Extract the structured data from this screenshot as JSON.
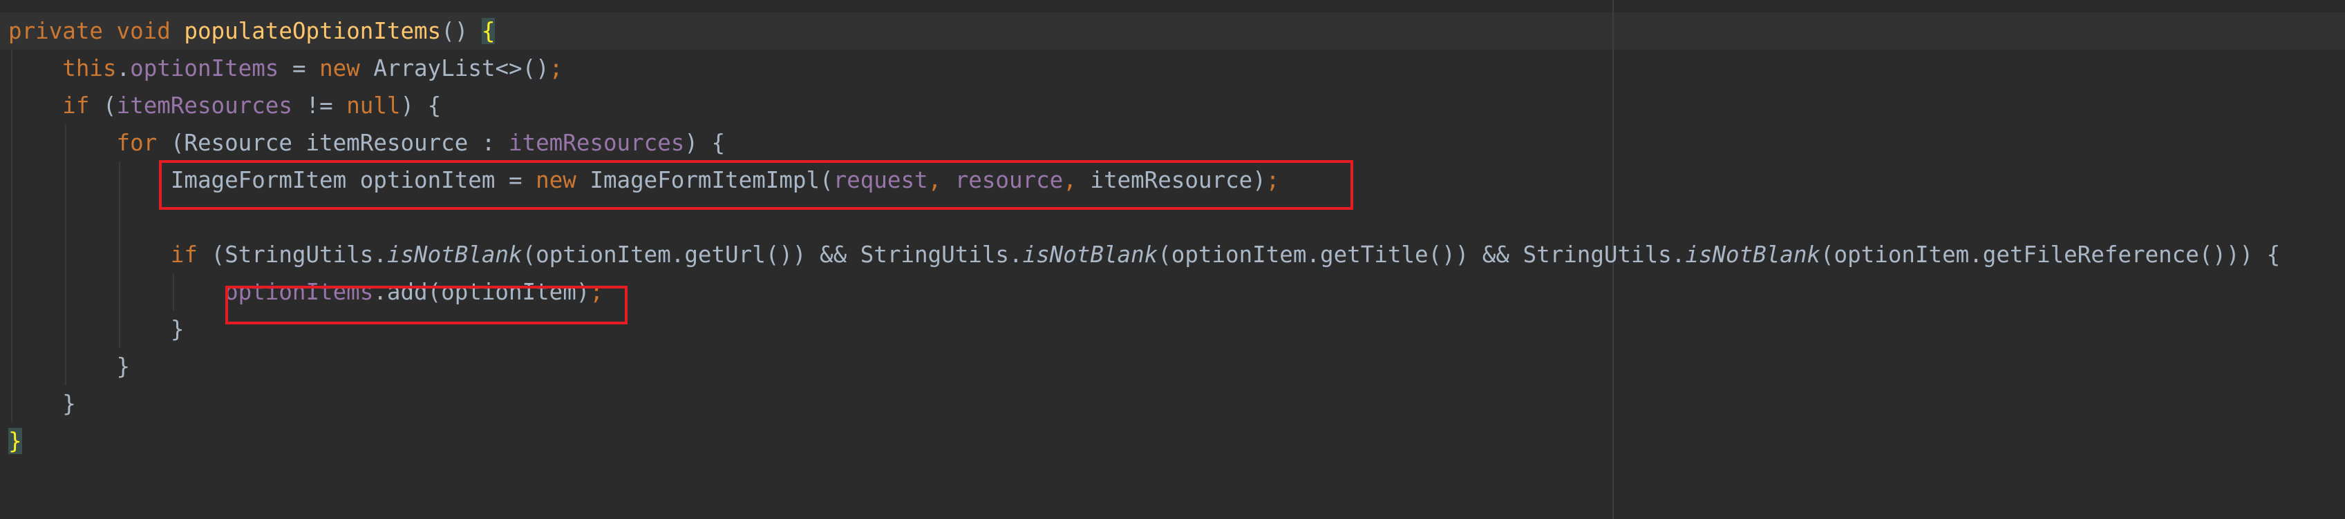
{
  "editor": {
    "language": "java",
    "colors": {
      "background": "#2b2b2b",
      "keyword": "#cc7832",
      "method_declaration": "#ffc66d",
      "field": "#9876aa",
      "plain": "#a9b7c6",
      "brace_match": "#ffef28",
      "annotation_box": "#e51c23"
    },
    "lines": [
      {
        "indent": "",
        "tokens": [
          {
            "t": "private",
            "c": "kw"
          },
          {
            "t": " ",
            "c": "plain"
          },
          {
            "t": "void",
            "c": "kw"
          },
          {
            "t": " ",
            "c": "plain"
          },
          {
            "t": "populateOptionItems",
            "c": "fn"
          },
          {
            "t": "() ",
            "c": "plain"
          },
          {
            "t": "{",
            "c": "brace-match"
          }
        ]
      },
      {
        "indent": "    ",
        "tokens": [
          {
            "t": "this",
            "c": "kw"
          },
          {
            "t": ".",
            "c": "plain"
          },
          {
            "t": "optionItems",
            "c": "field"
          },
          {
            "t": " = ",
            "c": "plain"
          },
          {
            "t": "new",
            "c": "kw"
          },
          {
            "t": " ArrayList<>()",
            "c": "plain"
          },
          {
            "t": ";",
            "c": "kw"
          }
        ]
      },
      {
        "indent": "    ",
        "tokens": [
          {
            "t": "if",
            "c": "kw"
          },
          {
            "t": " (",
            "c": "plain"
          },
          {
            "t": "itemResources",
            "c": "field"
          },
          {
            "t": " != ",
            "c": "plain"
          },
          {
            "t": "null",
            "c": "kw"
          },
          {
            "t": ") {",
            "c": "plain"
          }
        ]
      },
      {
        "indent": "        ",
        "tokens": [
          {
            "t": "for",
            "c": "kw"
          },
          {
            "t": " (Resource itemResource : ",
            "c": "plain"
          },
          {
            "t": "itemResources",
            "c": "field"
          },
          {
            "t": ") {",
            "c": "plain"
          }
        ]
      },
      {
        "indent": "            ",
        "tokens": [
          {
            "t": "ImageFormItem optionItem = ",
            "c": "plain"
          },
          {
            "t": "new",
            "c": "kw"
          },
          {
            "t": " ImageFormItemImpl(",
            "c": "plain"
          },
          {
            "t": "request",
            "c": "field"
          },
          {
            "t": ", ",
            "c": "kw"
          },
          {
            "t": "resource",
            "c": "field"
          },
          {
            "t": ", ",
            "c": "kw"
          },
          {
            "t": "itemResource)",
            "c": "plain"
          },
          {
            "t": ";",
            "c": "kw"
          }
        ]
      },
      {
        "indent": "",
        "tokens": []
      },
      {
        "indent": "            ",
        "tokens": [
          {
            "t": "if",
            "c": "kw"
          },
          {
            "t": " (StringUtils.",
            "c": "plain"
          },
          {
            "t": "isNotBlank",
            "c": "italic"
          },
          {
            "t": "(optionItem.getUrl()) && StringUtils.",
            "c": "plain"
          },
          {
            "t": "isNotBlank",
            "c": "italic"
          },
          {
            "t": "(optionItem.getTitle()) && StringUtils.",
            "c": "plain"
          },
          {
            "t": "isNotBlank",
            "c": "italic"
          },
          {
            "t": "(optionItem.getFileReference())) {",
            "c": "plain"
          }
        ]
      },
      {
        "indent": "                ",
        "tokens": [
          {
            "t": "optionItems",
            "c": "field"
          },
          {
            "t": ".add(optionItem)",
            "c": "plain"
          },
          {
            "t": ";",
            "c": "kw"
          }
        ]
      },
      {
        "indent": "            ",
        "tokens": [
          {
            "t": "}",
            "c": "plain"
          }
        ]
      },
      {
        "indent": "        ",
        "tokens": [
          {
            "t": "}",
            "c": "plain"
          }
        ]
      },
      {
        "indent": "    ",
        "tokens": [
          {
            "t": "}",
            "c": "plain"
          }
        ]
      },
      {
        "indent": "",
        "tokens": [
          {
            "t": "}",
            "c": "brace-match"
          }
        ]
      }
    ],
    "highlight_boxes": [
      {
        "label": "highlighted-statement",
        "line": 5
      },
      {
        "label": "highlighted-statement",
        "line": 8
      }
    ]
  }
}
